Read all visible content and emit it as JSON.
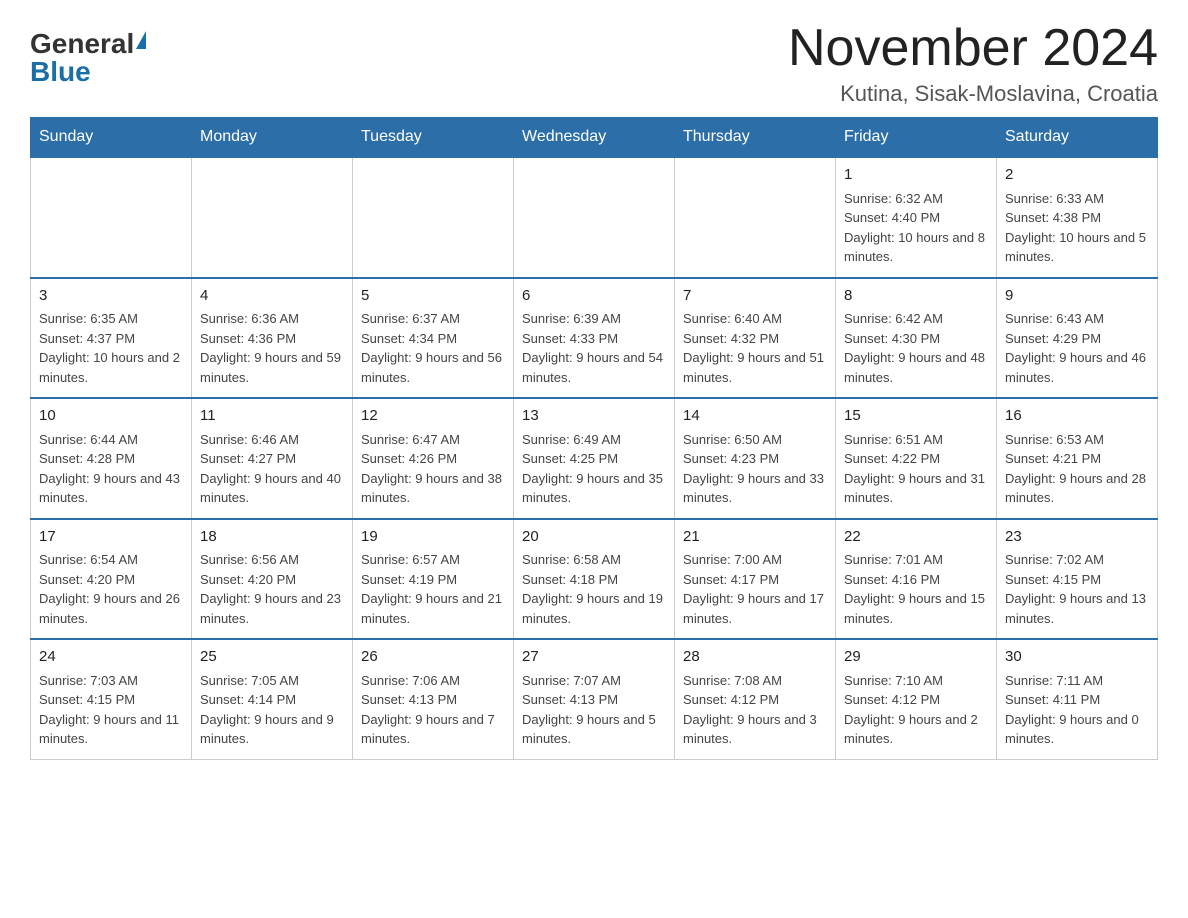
{
  "header": {
    "logo_general": "General",
    "logo_blue": "Blue",
    "title": "November 2024",
    "subtitle": "Kutina, Sisak-Moslavina, Croatia"
  },
  "calendar": {
    "days_of_week": [
      "Sunday",
      "Monday",
      "Tuesday",
      "Wednesday",
      "Thursday",
      "Friday",
      "Saturday"
    ],
    "weeks": [
      [
        {
          "day": "",
          "info": ""
        },
        {
          "day": "",
          "info": ""
        },
        {
          "day": "",
          "info": ""
        },
        {
          "day": "",
          "info": ""
        },
        {
          "day": "",
          "info": ""
        },
        {
          "day": "1",
          "info": "Sunrise: 6:32 AM\nSunset: 4:40 PM\nDaylight: 10 hours and 8 minutes."
        },
        {
          "day": "2",
          "info": "Sunrise: 6:33 AM\nSunset: 4:38 PM\nDaylight: 10 hours and 5 minutes."
        }
      ],
      [
        {
          "day": "3",
          "info": "Sunrise: 6:35 AM\nSunset: 4:37 PM\nDaylight: 10 hours and 2 minutes."
        },
        {
          "day": "4",
          "info": "Sunrise: 6:36 AM\nSunset: 4:36 PM\nDaylight: 9 hours and 59 minutes."
        },
        {
          "day": "5",
          "info": "Sunrise: 6:37 AM\nSunset: 4:34 PM\nDaylight: 9 hours and 56 minutes."
        },
        {
          "day": "6",
          "info": "Sunrise: 6:39 AM\nSunset: 4:33 PM\nDaylight: 9 hours and 54 minutes."
        },
        {
          "day": "7",
          "info": "Sunrise: 6:40 AM\nSunset: 4:32 PM\nDaylight: 9 hours and 51 minutes."
        },
        {
          "day": "8",
          "info": "Sunrise: 6:42 AM\nSunset: 4:30 PM\nDaylight: 9 hours and 48 minutes."
        },
        {
          "day": "9",
          "info": "Sunrise: 6:43 AM\nSunset: 4:29 PM\nDaylight: 9 hours and 46 minutes."
        }
      ],
      [
        {
          "day": "10",
          "info": "Sunrise: 6:44 AM\nSunset: 4:28 PM\nDaylight: 9 hours and 43 minutes."
        },
        {
          "day": "11",
          "info": "Sunrise: 6:46 AM\nSunset: 4:27 PM\nDaylight: 9 hours and 40 minutes."
        },
        {
          "day": "12",
          "info": "Sunrise: 6:47 AM\nSunset: 4:26 PM\nDaylight: 9 hours and 38 minutes."
        },
        {
          "day": "13",
          "info": "Sunrise: 6:49 AM\nSunset: 4:25 PM\nDaylight: 9 hours and 35 minutes."
        },
        {
          "day": "14",
          "info": "Sunrise: 6:50 AM\nSunset: 4:23 PM\nDaylight: 9 hours and 33 minutes."
        },
        {
          "day": "15",
          "info": "Sunrise: 6:51 AM\nSunset: 4:22 PM\nDaylight: 9 hours and 31 minutes."
        },
        {
          "day": "16",
          "info": "Sunrise: 6:53 AM\nSunset: 4:21 PM\nDaylight: 9 hours and 28 minutes."
        }
      ],
      [
        {
          "day": "17",
          "info": "Sunrise: 6:54 AM\nSunset: 4:20 PM\nDaylight: 9 hours and 26 minutes."
        },
        {
          "day": "18",
          "info": "Sunrise: 6:56 AM\nSunset: 4:20 PM\nDaylight: 9 hours and 23 minutes."
        },
        {
          "day": "19",
          "info": "Sunrise: 6:57 AM\nSunset: 4:19 PM\nDaylight: 9 hours and 21 minutes."
        },
        {
          "day": "20",
          "info": "Sunrise: 6:58 AM\nSunset: 4:18 PM\nDaylight: 9 hours and 19 minutes."
        },
        {
          "day": "21",
          "info": "Sunrise: 7:00 AM\nSunset: 4:17 PM\nDaylight: 9 hours and 17 minutes."
        },
        {
          "day": "22",
          "info": "Sunrise: 7:01 AM\nSunset: 4:16 PM\nDaylight: 9 hours and 15 minutes."
        },
        {
          "day": "23",
          "info": "Sunrise: 7:02 AM\nSunset: 4:15 PM\nDaylight: 9 hours and 13 minutes."
        }
      ],
      [
        {
          "day": "24",
          "info": "Sunrise: 7:03 AM\nSunset: 4:15 PM\nDaylight: 9 hours and 11 minutes."
        },
        {
          "day": "25",
          "info": "Sunrise: 7:05 AM\nSunset: 4:14 PM\nDaylight: 9 hours and 9 minutes."
        },
        {
          "day": "26",
          "info": "Sunrise: 7:06 AM\nSunset: 4:13 PM\nDaylight: 9 hours and 7 minutes."
        },
        {
          "day": "27",
          "info": "Sunrise: 7:07 AM\nSunset: 4:13 PM\nDaylight: 9 hours and 5 minutes."
        },
        {
          "day": "28",
          "info": "Sunrise: 7:08 AM\nSunset: 4:12 PM\nDaylight: 9 hours and 3 minutes."
        },
        {
          "day": "29",
          "info": "Sunrise: 7:10 AM\nSunset: 4:12 PM\nDaylight: 9 hours and 2 minutes."
        },
        {
          "day": "30",
          "info": "Sunrise: 7:11 AM\nSunset: 4:11 PM\nDaylight: 9 hours and 0 minutes."
        }
      ]
    ]
  }
}
